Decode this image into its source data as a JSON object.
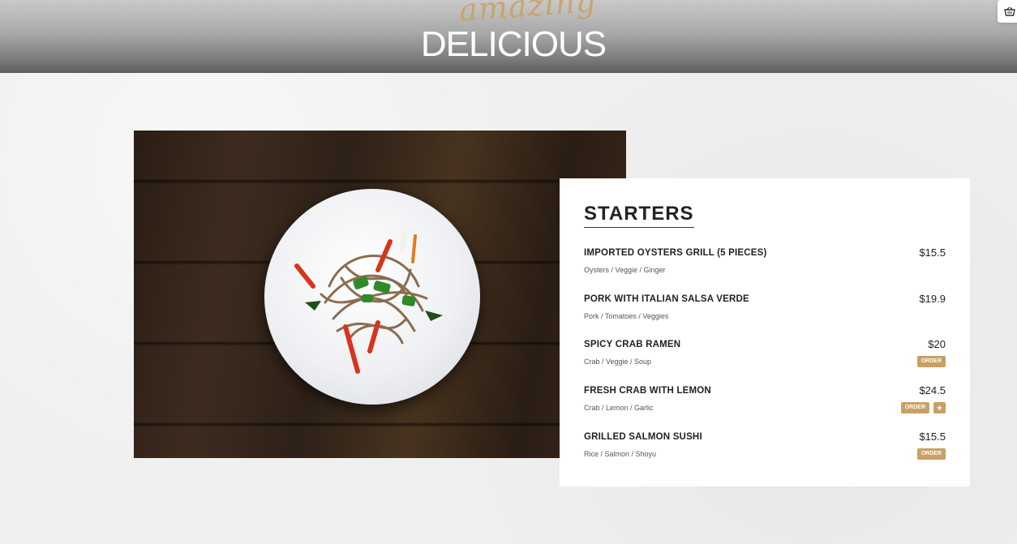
{
  "header": {
    "script_word": "amazing",
    "title": "DELICIOUS"
  },
  "icons": {
    "cart": "basket-icon",
    "star": "star-icon"
  },
  "colors": {
    "accent": "#c9a064",
    "card_bg": "#ffffff",
    "page_bg": "#efefef"
  },
  "menu": {
    "heading": "STARTERS",
    "items": [
      {
        "name": "IMPORTED OYSTERS GRILL (5 PIECES)",
        "price": "$15.5",
        "desc": "Oysters / Veggie / Ginger"
      },
      {
        "name": "PORK WITH ITALIAN SALSA VERDE",
        "price": "$19.9",
        "desc": "Pork / Tomatoes / Veggies"
      },
      {
        "name": "SPICY CRAB RAMEN",
        "price": "$20",
        "desc": "Crab / Veggie / Soup",
        "order_label": "ORDER"
      },
      {
        "name": "FRESH CRAB WITH LEMON",
        "price": "$24.5",
        "desc": "Crab / Lemon / Garlic",
        "order_label": "ORDER",
        "star": "★"
      },
      {
        "name": "GRILLED SALMON SUSHI",
        "price": "$15.5",
        "desc": "Rice / Salmon / Shoyu",
        "order_label": "ORDER"
      }
    ]
  }
}
